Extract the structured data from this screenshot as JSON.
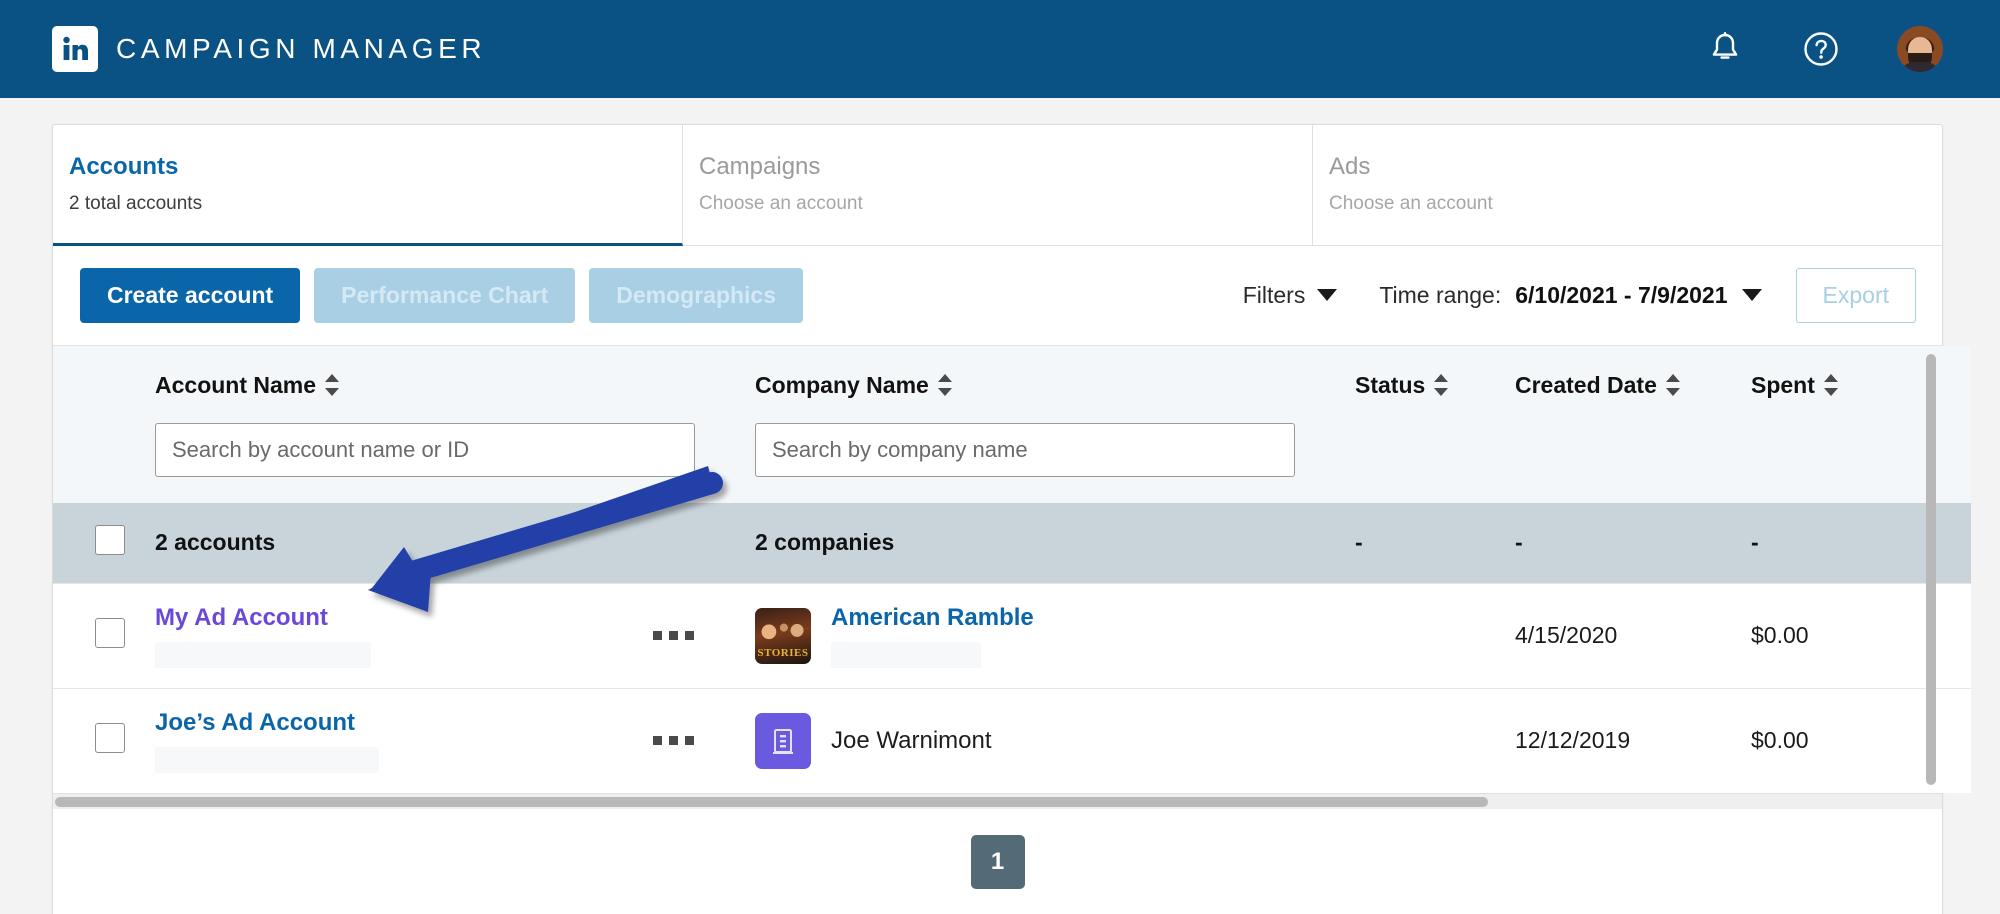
{
  "header": {
    "brand_title": "CAMPAIGN MANAGER",
    "logo_icon": "linkedin-logo-icon",
    "notifications_icon": "bell-icon",
    "help_icon": "question-circle-icon",
    "avatar_icon": "user-avatar"
  },
  "tabs": [
    {
      "label": "Accounts",
      "sub": "2 total accounts",
      "active": true
    },
    {
      "label": "Campaigns",
      "sub": "Choose an account",
      "active": false
    },
    {
      "label": "Ads",
      "sub": "Choose an account",
      "active": false
    }
  ],
  "toolbar": {
    "create_account_label": "Create account",
    "performance_chart_label": "Performance Chart",
    "demographics_label": "Demographics",
    "filters_label": "Filters",
    "time_range_label": "Time range:",
    "time_range_value": "6/10/2021 - 7/9/2021",
    "export_label": "Export"
  },
  "table": {
    "columns": [
      {
        "key": "checkbox",
        "label": "",
        "sortable": false
      },
      {
        "key": "account_name",
        "label": "Account Name",
        "sortable": true
      },
      {
        "key": "company_name",
        "label": "Company Name",
        "sortable": true
      },
      {
        "key": "status",
        "label": "Status",
        "sortable": true
      },
      {
        "key": "created_date",
        "label": "Created Date",
        "sortable": true
      },
      {
        "key": "spent",
        "label": "Spent",
        "sortable": true
      }
    ],
    "search": {
      "account_placeholder": "Search by account name or ID",
      "account_value": "",
      "company_placeholder": "Search by company name",
      "company_value": ""
    },
    "summary": {
      "accounts": "2 accounts",
      "companies": "2 companies",
      "status": "-",
      "created_date": "-",
      "spent": "-"
    },
    "rows": [
      {
        "account_name": "My Ad Account",
        "account_link_state": "visited",
        "company_name": "American Ramble",
        "company_is_link": true,
        "company_logo": "american-ramble-logo",
        "status": "",
        "created_date": "4/15/2020",
        "spent": "$0.00",
        "menu_icon": "ellipsis-icon"
      },
      {
        "account_name": "Joe’s Ad Account",
        "account_link_state": "unvisited",
        "company_name": "Joe Warnimont",
        "company_is_link": false,
        "company_logo": "building-placeholder-logo",
        "status": "",
        "created_date": "12/12/2019",
        "spent": "$0.00",
        "menu_icon": "ellipsis-icon"
      }
    ]
  },
  "pagination": {
    "current_page": "1"
  },
  "annotation": {
    "type": "arrow",
    "points_to": "My Ad Account",
    "color": "#2440a8"
  },
  "colors": {
    "brand_navy": "#0b5284",
    "link_blue": "#0a66a8",
    "visited_purple": "#6a49d8",
    "muted_button": "#a8cfe4",
    "summary_row": "#c8d4da",
    "page_btn": "#546a76",
    "annotation_arrow": "#2440a8"
  }
}
